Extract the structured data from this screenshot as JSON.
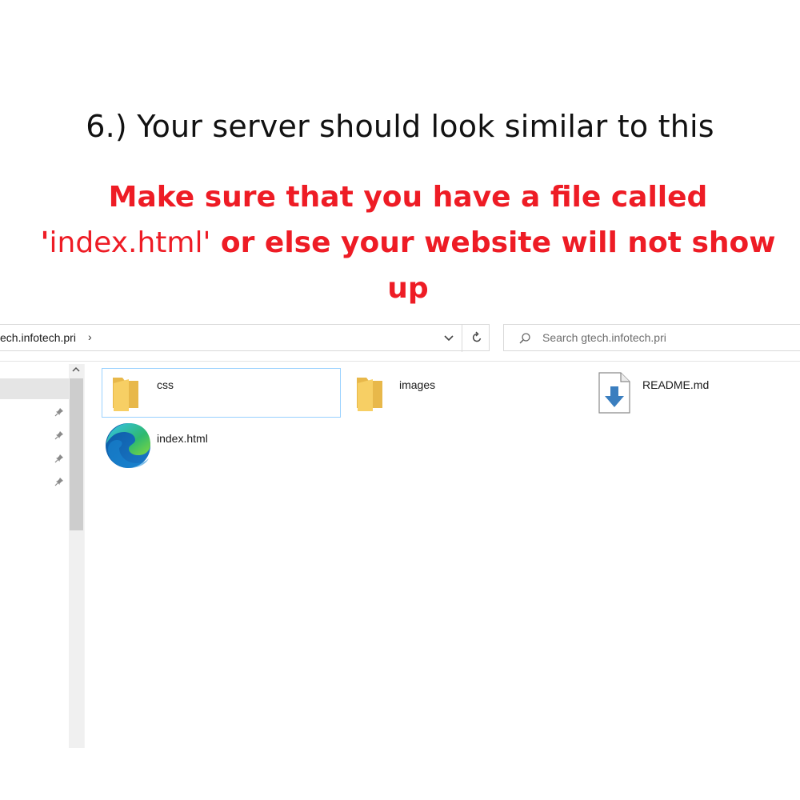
{
  "instructions": {
    "heading": "6.) Your server should look similar to this",
    "warning_part1": "Make sure that you have a file called",
    "warning_quote_open": "'",
    "warning_filename": "index.html'",
    "warning_part2": " or else your website will not show up"
  },
  "explorer": {
    "address_path": "ech.infotech.pri",
    "address_separator": "›",
    "search_placeholder": "Search gtech.infotech.pri",
    "files": [
      {
        "name": "css",
        "icon": "folder-icon"
      },
      {
        "name": "images",
        "icon": "folder-icon"
      },
      {
        "name": "README.md",
        "icon": "download-file-icon"
      },
      {
        "name": "index.html",
        "icon": "edge-browser-icon"
      }
    ]
  },
  "colors": {
    "warning": "#ee1c25",
    "selection_border": "#99d1ff",
    "folder": "#f7cf64",
    "file_arrow": "#3a7ebf"
  }
}
